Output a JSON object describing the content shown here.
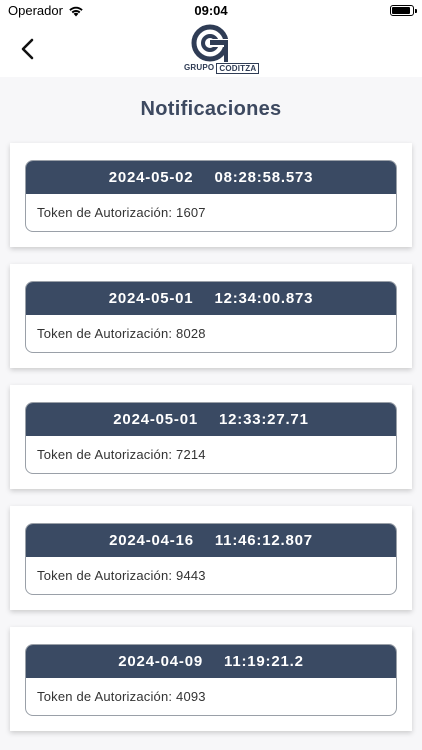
{
  "status_bar": {
    "carrier": "Operador",
    "time": "09:04"
  },
  "header": {
    "logo_text_1": "GRUPO",
    "logo_text_2": "CODITZA"
  },
  "page": {
    "title": "Notificaciones"
  },
  "notifications": [
    {
      "date": "2024-05-02",
      "time": "08:28:58.573",
      "body": "Token de Autorización: 1607"
    },
    {
      "date": "2024-05-01",
      "time": "12:34:00.873",
      "body": "Token de Autorización: 8028"
    },
    {
      "date": "2024-05-01",
      "time": "12:33:27.71",
      "body": "Token de Autorización: 7214"
    },
    {
      "date": "2024-04-16",
      "time": "11:46:12.807",
      "body": "Token de Autorización: 9443"
    },
    {
      "date": "2024-04-09",
      "time": "11:19:21.2",
      "body": "Token de Autorización: 4093"
    }
  ],
  "colors": {
    "header_bg": "#3a4a63",
    "title": "#3d4960",
    "background": "#f7f7f9"
  }
}
